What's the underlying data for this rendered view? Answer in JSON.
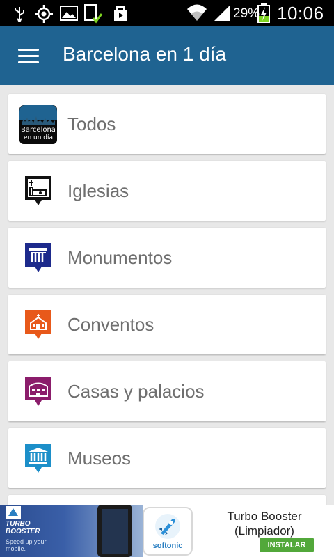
{
  "status_bar": {
    "battery_percent": "29%",
    "time": "10:06",
    "icons": [
      "usb-icon",
      "gps-icon",
      "image-icon",
      "download-check-icon",
      "bag-icon",
      "wifi-icon",
      "signal-icon",
      "battery-charging-icon"
    ]
  },
  "app_bar": {
    "menu_icon": "hamburger-menu-icon",
    "title": "Barcelona en 1 día",
    "color": "#1f6391"
  },
  "categories": [
    {
      "label": "Todos",
      "icon": "barcelona-app-icon",
      "icon_text": "Barcelona en un día"
    },
    {
      "label": "Iglesias",
      "icon": "church-icon",
      "color": "#111111"
    },
    {
      "label": "Monumentos",
      "icon": "monument-icon",
      "color": "#1d2a8c"
    },
    {
      "label": "Conventos",
      "icon": "convent-icon",
      "color": "#e8591a"
    },
    {
      "label": "Casas y palacios",
      "icon": "palace-icon",
      "color": "#8b1d6b"
    },
    {
      "label": "Museos",
      "icon": "museum-icon",
      "color": "#1c8fc9"
    }
  ],
  "ad": {
    "promo_title": "TURBO BOOSTER",
    "promo_subtitle": "Speed up your mobile.",
    "brand": "softonic",
    "title_line1": "Turbo Booster",
    "title_line2": "(Limpiador)",
    "install_label": "INSTALAR",
    "install_color": "#52a83a"
  }
}
